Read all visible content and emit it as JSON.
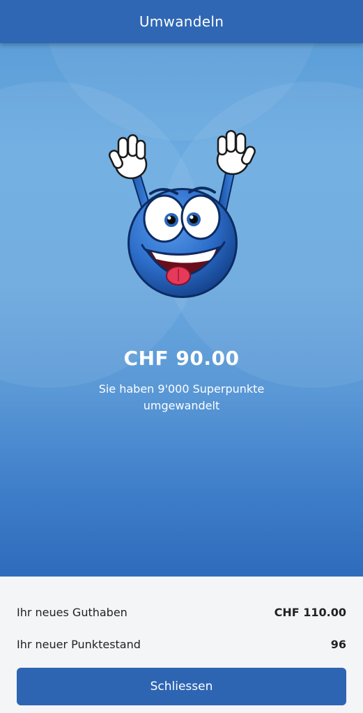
{
  "header": {
    "title": "Umwandeln"
  },
  "hero": {
    "amount": "CHF 90.00",
    "message": "Sie haben 9'000 Superpunkte umgewandelt",
    "mascot_icon": "happy-blue-mascot-icon"
  },
  "summary": {
    "balance_label": "Ihr neues Guthaben",
    "balance_value": "CHF 110.00",
    "points_label": "Ihr neuer Punktestand",
    "points_value": "96"
  },
  "actions": {
    "close_label": "Schliessen"
  },
  "colors": {
    "header": "#2f67b4",
    "button": "#2e65b3",
    "hero_top": "#5c9ed8",
    "hero_bottom": "#2f6bbc",
    "mascot_body": "#2f72cf"
  }
}
